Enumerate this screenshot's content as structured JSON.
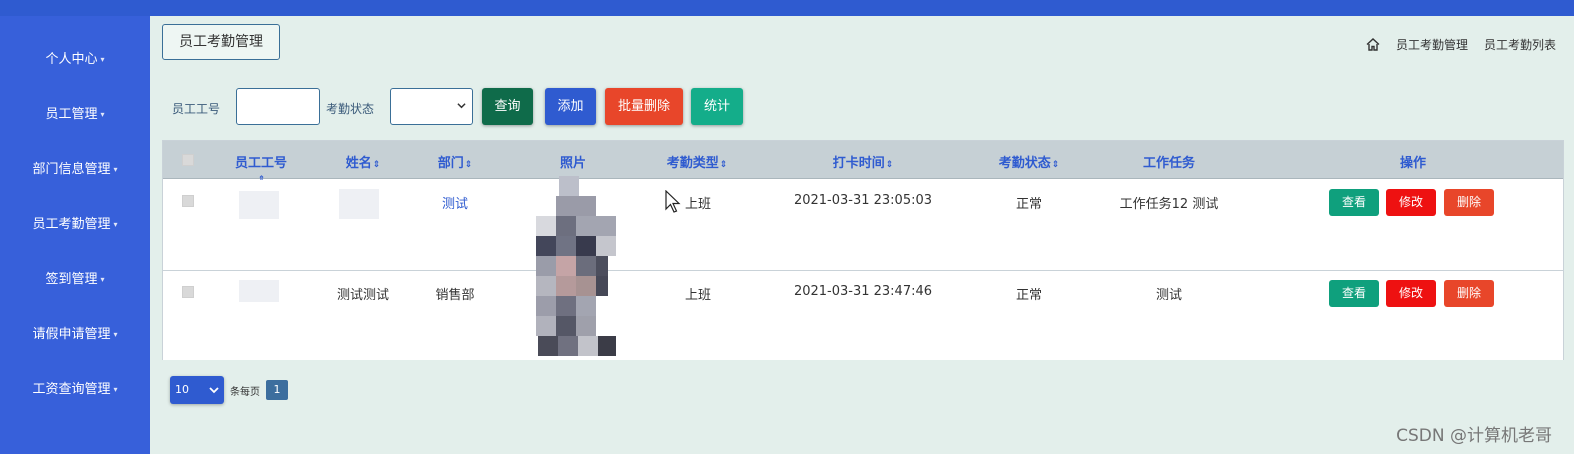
{
  "sidebar": {
    "items": [
      {
        "label": "个人中心"
      },
      {
        "label": "员工管理"
      },
      {
        "label": "部门信息管理"
      },
      {
        "label": "员工考勤管理"
      },
      {
        "label": "签到管理"
      },
      {
        "label": "请假申请管理"
      },
      {
        "label": "工资查询管理"
      }
    ]
  },
  "header": {
    "title": "员工考勤管理",
    "breadcrumb": [
      "员工考勤管理",
      "员工考勤列表"
    ]
  },
  "filter": {
    "employee_id_label": "员工工号",
    "employee_id_value": "",
    "status_label": "考勤状态",
    "status_value": "",
    "buttons": {
      "search": "查询",
      "add": "添加",
      "batch_delete": "批量删除",
      "stats": "统计"
    }
  },
  "table": {
    "columns": [
      "员工工号",
      "姓名",
      "部门",
      "照片",
      "考勤类型",
      "打卡时间",
      "考勤状态",
      "工作任务",
      "操作"
    ],
    "sort_glyph": "⇕",
    "rows": [
      {
        "dept": "测试",
        "name": "",
        "type": "上班",
        "time": "2021-03-31 23:05:03",
        "status": "正常",
        "task": "工作任务12 测试"
      },
      {
        "dept": "销售部",
        "name": "测试测试",
        "type": "上班",
        "time": "2021-03-31 23:47:46",
        "status": "正常",
        "task": "测试"
      }
    ],
    "actions": {
      "view": "查看",
      "edit": "修改",
      "delete": "删除"
    }
  },
  "pager": {
    "page_size": "10",
    "page_size_suffix": "条每页",
    "current_page": "1"
  },
  "watermark": "CSDN @计算机老哥",
  "colors": {
    "sidebar": "#3760da",
    "search": "#0f6b4a",
    "add": "#2f5bd0",
    "batch_delete": "#e8462a",
    "stats": "#14ad8a",
    "view": "#0fa07d",
    "edit": "#ee1111",
    "delete": "#e8462a"
  }
}
